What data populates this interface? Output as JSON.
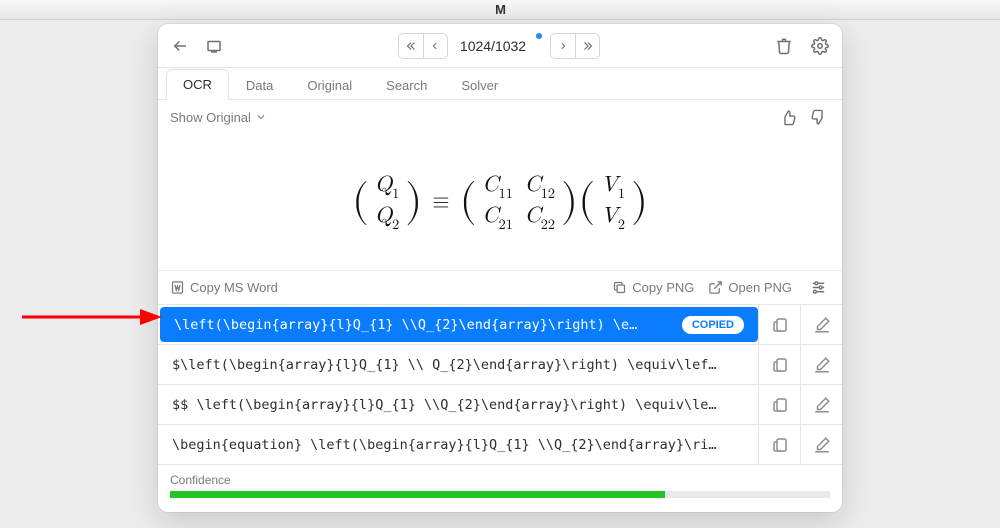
{
  "titlebar": {
    "logo_text": "M"
  },
  "toolbar": {
    "page_indicator": "1024/1032"
  },
  "tabs": [
    {
      "label": "OCR",
      "active": true
    },
    {
      "label": "Data",
      "active": false
    },
    {
      "label": "Original",
      "active": false
    },
    {
      "label": "Search",
      "active": false
    },
    {
      "label": "Solver",
      "active": false
    }
  ],
  "subbar": {
    "show_original": "Show Original"
  },
  "equation": {
    "left_rows": [
      "Q",
      "Q"
    ],
    "left_subs": [
      "1",
      "2"
    ],
    "equiv": "≡",
    "c_rows": [
      [
        "C",
        "C"
      ],
      [
        "C",
        "C"
      ]
    ],
    "c_subs": [
      [
        "11",
        "12"
      ],
      [
        "21",
        "22"
      ]
    ],
    "v_rows": [
      "V",
      "V"
    ],
    "v_subs": [
      "1",
      "2"
    ]
  },
  "actions": {
    "copy_word": "Copy MS Word",
    "copy_png": "Copy PNG",
    "open_png": "Open PNG"
  },
  "latex_rows": [
    {
      "text": "\\left(\\begin{array}{l}Q_{1} \\\\Q_{2}\\end{array}\\right) \\e…",
      "selected": true,
      "copied_label": "COPIED"
    },
    {
      "text": "$\\left(\\begin{array}{l}Q_{1} \\\\ Q_{2}\\end{array}\\right) \\equiv\\lef…",
      "selected": false
    },
    {
      "text": "$$ \\left(\\begin{array}{l}Q_{1} \\\\Q_{2}\\end{array}\\right) \\equiv\\le…",
      "selected": false
    },
    {
      "text": "\\begin{equation} \\left(\\begin{array}{l}Q_{1} \\\\Q_{2}\\end{array}\\ri…",
      "selected": false
    }
  ],
  "confidence": {
    "label": "Confidence",
    "percent": 75
  },
  "colors": {
    "accent": "#0a7dff",
    "confidence_fill": "#25c425"
  }
}
